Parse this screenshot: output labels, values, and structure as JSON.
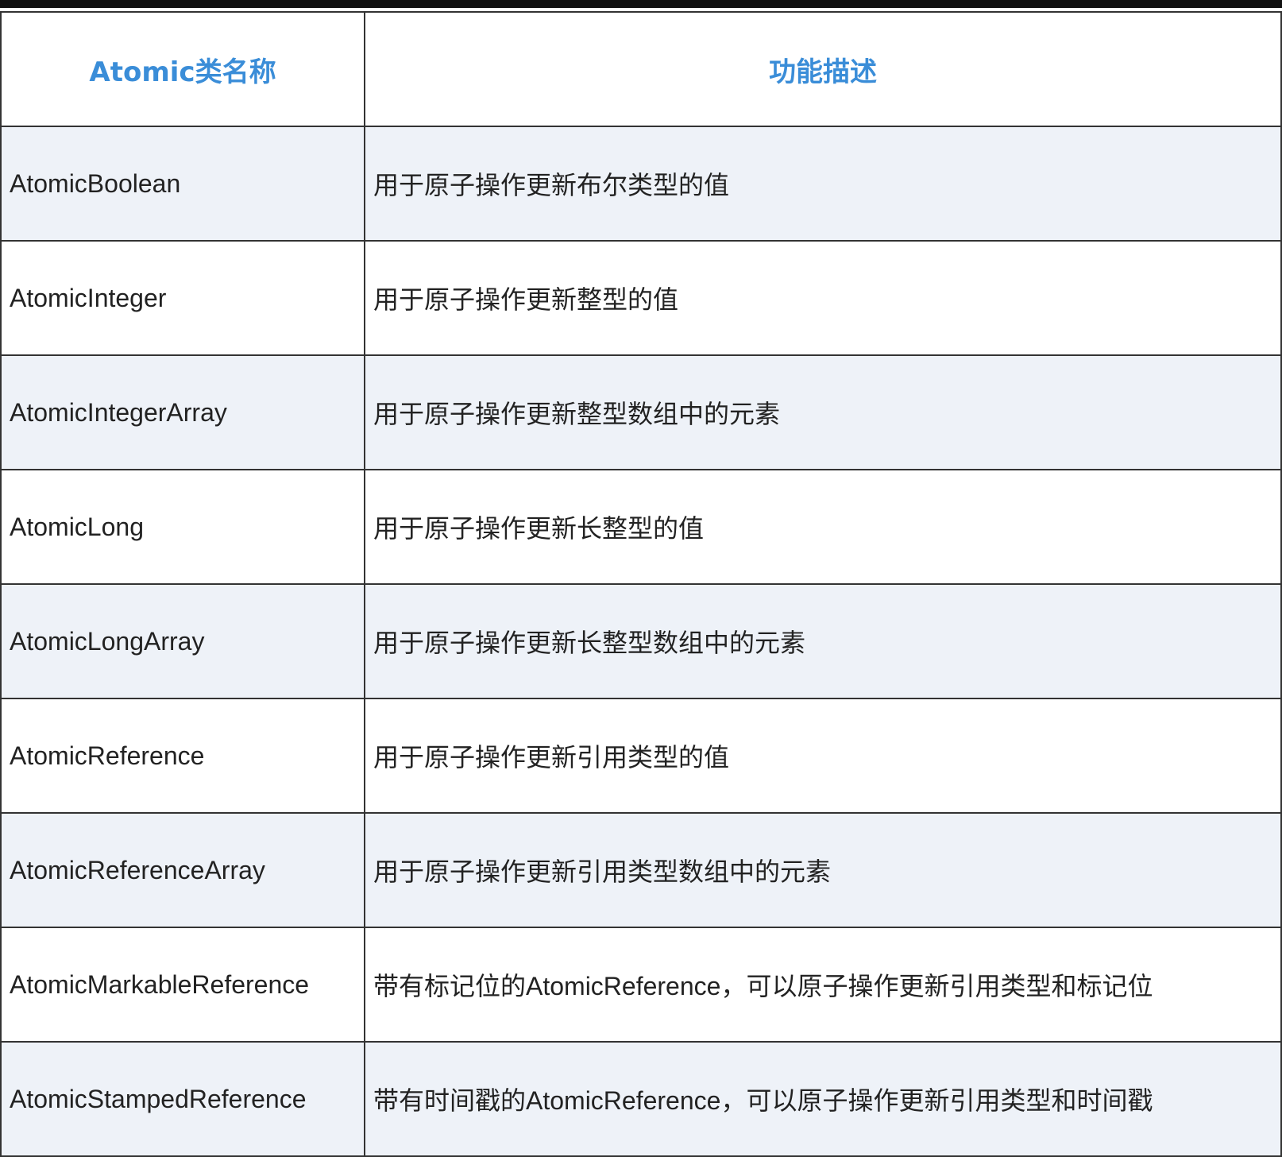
{
  "table": {
    "headers": [
      "Atomic类名称",
      "功能描述"
    ],
    "rows": [
      [
        "AtomicBoolean",
        "用于原子操作更新布尔类型的值"
      ],
      [
        "AtomicInteger",
        "用于原子操作更新整型的值"
      ],
      [
        "AtomicIntegerArray",
        "用于原子操作更新整型数组中的元素"
      ],
      [
        "AtomicLong",
        "用于原子操作更新长整型的值"
      ],
      [
        "AtomicLongArray",
        "用于原子操作更新长整型数组中的元素"
      ],
      [
        "AtomicReference",
        "用于原子操作更新引用类型的值"
      ],
      [
        "AtomicReferenceArray",
        "用于原子操作更新引用类型数组中的元素"
      ],
      [
        "AtomicMarkableReference",
        "带有标记位的AtomicReference，可以原子操作更新引用类型和标记位"
      ],
      [
        "AtomicStampedReference",
        "带有时间戳的AtomicReference，可以原子操作更新引用类型和时间戳"
      ]
    ]
  },
  "colors": {
    "header_text": "#3a8dd8",
    "stripe": "#eef2f8",
    "border": "#333333"
  }
}
